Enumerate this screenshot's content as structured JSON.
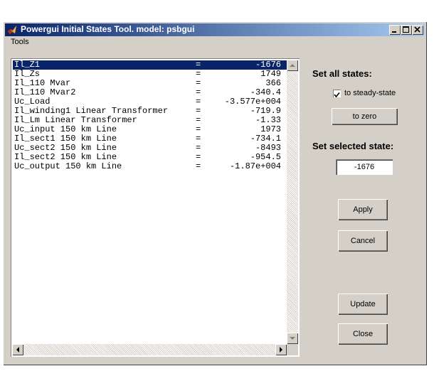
{
  "window": {
    "title": "Powergui Initial States Tool. model: psbgui"
  },
  "menu": {
    "tools": "Tools"
  },
  "states": [
    {
      "name": "Il_Z1",
      "eq": "=",
      "value": "-1676",
      "selected": true
    },
    {
      "name": "Il_Zs",
      "eq": "=",
      "value": "1749"
    },
    {
      "name": "Il_110 Mvar",
      "eq": "=",
      "value": "366"
    },
    {
      "name": "Il_110 Mvar2",
      "eq": "=",
      "value": "-340.4"
    },
    {
      "name": "Uc_Load",
      "eq": "=",
      "value": "-3.577e+004"
    },
    {
      "name": "Il_winding1 Linear Transformer",
      "eq": "=",
      "value": "-719.9"
    },
    {
      "name": "Il_Lm Linear Transformer",
      "eq": "=",
      "value": "-1.33"
    },
    {
      "name": "Uc_input 150 km Line",
      "eq": "=",
      "value": "1973"
    },
    {
      "name": "Il_sect1 150 km Line",
      "eq": "=",
      "value": "-734.1"
    },
    {
      "name": "Uc_sect2 150 km Line",
      "eq": "=",
      "value": "-8493"
    },
    {
      "name": "Il_sect2 150 km Line",
      "eq": "=",
      "value": "-954.5"
    },
    {
      "name": "Uc_output 150 km Line",
      "eq": "=",
      "value": "-1.87e+004"
    }
  ],
  "panel": {
    "set_all_label": "Set all states:",
    "steady_state_label": "to steady-state",
    "steady_state_checked": true,
    "to_zero_label": "to zero",
    "set_selected_label": "Set selected state:",
    "selected_value": "-1676",
    "apply_label": "Apply",
    "cancel_label": "Cancel",
    "update_label": "Update",
    "close_label": "Close"
  },
  "colors": {
    "title_start": "#0a246a",
    "title_end": "#a6caf0",
    "face": "#d4d0c8",
    "selection": "#0a246a"
  }
}
